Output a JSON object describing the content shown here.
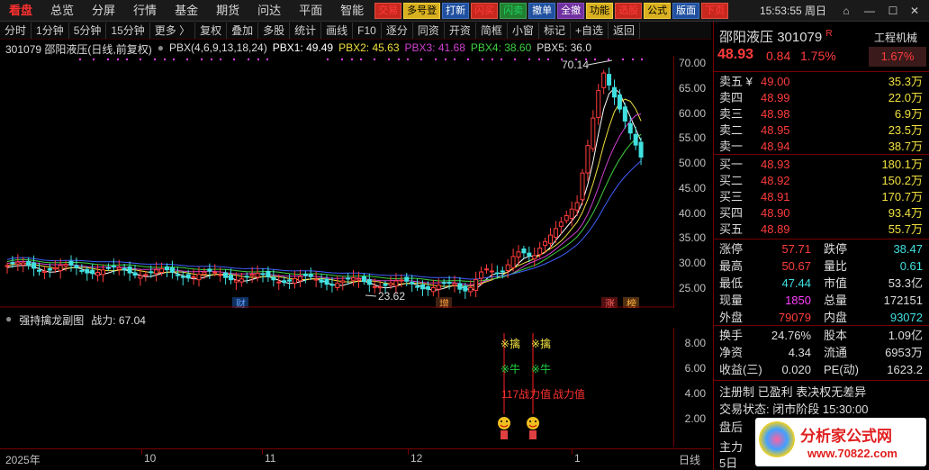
{
  "menu": [
    "看盘",
    "总览",
    "分屏",
    "行情",
    "基金",
    "期货",
    "问达",
    "平面",
    "智能"
  ],
  "tools": [
    {
      "label": "交易",
      "style": "red"
    },
    {
      "label": "多号登",
      "style": "yellow"
    },
    {
      "label": "打新",
      "style": "blue"
    },
    {
      "label": "闪买",
      "style": "red"
    },
    {
      "label": "闪卖",
      "style": "green"
    },
    {
      "label": "撤单",
      "style": "blue"
    },
    {
      "label": "全撤",
      "style": "purple"
    },
    {
      "label": "功能",
      "style": "yellow"
    },
    {
      "label": "选股",
      "style": "red"
    },
    {
      "label": "公式",
      "style": "yellow"
    },
    {
      "label": "版面",
      "style": "blue"
    },
    {
      "label": "下页",
      "style": "red"
    }
  ],
  "clock": "15:53:55 周日",
  "toolbar": [
    "分时",
    "1分钟",
    "5分钟",
    "15分钟",
    "更多 〉",
    "复权",
    "叠加",
    "多股",
    "统计",
    "画线",
    "F10",
    "逐分",
    "同资",
    "开资",
    "简框",
    "小窗",
    "标记",
    "+自选",
    "返回"
  ],
  "info": {
    "code_name": "301079 邵阳液压(日线,前复权)",
    "pbx_params": "PBX(4,6,9,13,18,24)",
    "pbx1": "PBX1: 49.49",
    "pbx2": "PBX2: 45.63",
    "pbx3": "PBX3: 41.68",
    "pbx4": "PBX4: 38.60",
    "pbx5": "PBX5: 36.0"
  },
  "price_axis": [
    "70.00",
    "65.00",
    "60.00",
    "55.00",
    "50.00",
    "45.00",
    "40.00",
    "35.00",
    "30.00",
    "25.00"
  ],
  "annotations": {
    "high_label": "70.14",
    "low_label": "23.62",
    "cai": "财",
    "zeng": "增",
    "zhang": "涨",
    "bang": "榜"
  },
  "sub": {
    "title": "强持擒龙副图",
    "value": "战力: 67.04",
    "axis": [
      "8.00",
      "6.00",
      "4.00",
      "2.00"
    ],
    "sig_qin": "※擒",
    "sig_niu": "※牛",
    "sig_text": "117战力值",
    "sig_text2": "战力值"
  },
  "dates": [
    "2025年",
    "10",
    "11",
    "12",
    "1",
    "日线"
  ],
  "quote": {
    "name": "邵阳液压",
    "code": "301079",
    "flag": "R",
    "industry": "工程机械",
    "price": "48.93",
    "change": "0.84",
    "change_pct": "1.75%",
    "industry_pct": "1.67%",
    "asks": [
      {
        "label": "卖五 ¥",
        "price": "49.00",
        "vol": "35.3万"
      },
      {
        "label": "卖四",
        "price": "48.99",
        "vol": "22.0万"
      },
      {
        "label": "卖三",
        "price": "48.98",
        "vol": "6.9万"
      },
      {
        "label": "卖二",
        "price": "48.95",
        "vol": "23.5万"
      },
      {
        "label": "卖一",
        "price": "48.94",
        "vol": "38.7万"
      }
    ],
    "bids": [
      {
        "label": "买一",
        "price": "48.93",
        "vol": "180.1万"
      },
      {
        "label": "买二",
        "price": "48.92",
        "vol": "150.2万"
      },
      {
        "label": "买三",
        "price": "48.91",
        "vol": "170.7万"
      },
      {
        "label": "买四",
        "price": "48.90",
        "vol": "93.4万"
      },
      {
        "label": "买五",
        "price": "48.89",
        "vol": "55.7万"
      }
    ],
    "stats": [
      {
        "l1": "涨停",
        "v1": "57.71",
        "c1": "red",
        "l2": "跌停",
        "v2": "38.47",
        "c2": "cyan"
      },
      {
        "l1": "最高",
        "v1": "50.67",
        "c1": "red",
        "l2": "量比",
        "v2": "0.61",
        "c2": "cyan"
      },
      {
        "l1": "最低",
        "v1": "47.44",
        "c1": "cyan",
        "l2": "市值",
        "v2": "53.3亿",
        "c2": "white"
      },
      {
        "l1": "现量",
        "v1": "1850",
        "c1": "magenta",
        "l2": "总量",
        "v2": "172151",
        "c2": "white"
      },
      {
        "l1": "外盘",
        "v1": "79079",
        "c1": "red",
        "l2": "内盘",
        "v2": "93072",
        "c2": "cyan"
      }
    ],
    "stats2": [
      {
        "l1": "换手",
        "v1": "24.76%",
        "l2": "股本",
        "v2": "1.09亿"
      },
      {
        "l1": "净资",
        "v1": "4.34",
        "l2": "流通",
        "v2": "6953万"
      },
      {
        "l1": "收益(三)",
        "v1": "0.020",
        "l2": "PE(动)",
        "v2": "1623.2"
      }
    ],
    "tags": "注册制 已盈利 表决权无差异",
    "status": "交易状态: 闭市阶段 15:30:00",
    "status2": "盘后",
    "row_main": "主力",
    "row_5d": "5日",
    "logo_title": "分析家公式网",
    "logo_url": "www.70822.com"
  }
}
